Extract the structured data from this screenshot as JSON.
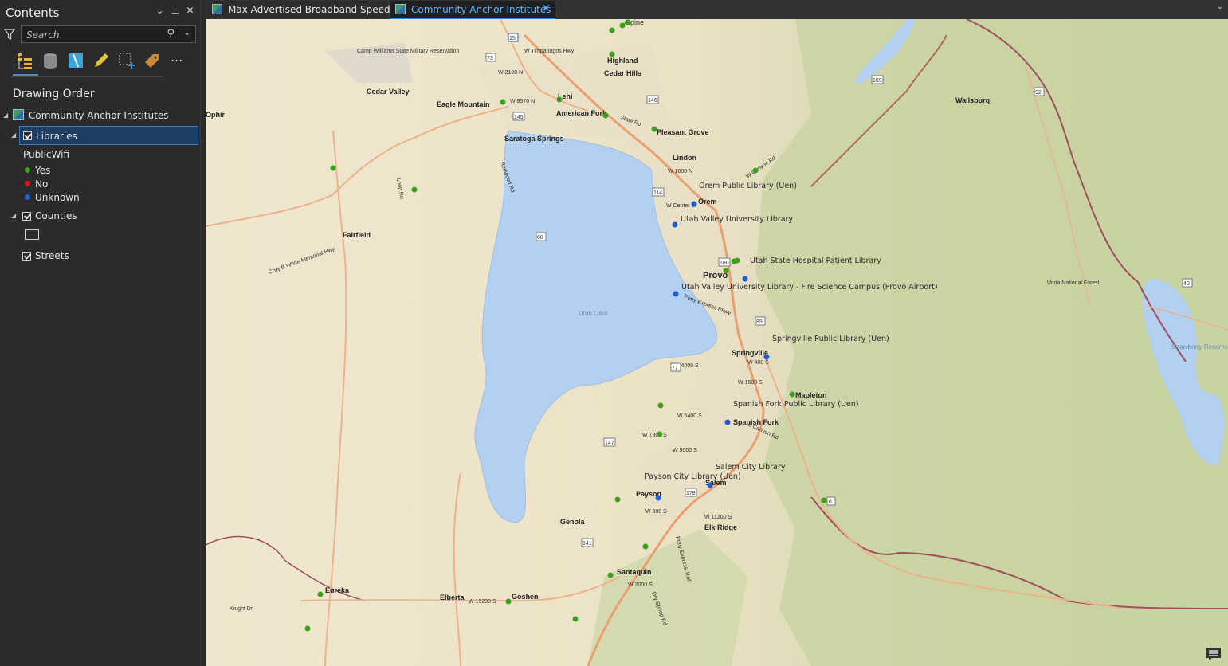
{
  "contents": {
    "title": "Contents",
    "header_icons": [
      "chevron-down-icon",
      "pin-icon",
      "close-icon"
    ],
    "search_placeholder": "Search",
    "toolbar": [
      "list-by-drawing-order-icon",
      "list-by-data-source-icon",
      "list-by-selection-icon",
      "list-by-editing-icon",
      "list-by-snapping-icon",
      "list-by-labeling-icon",
      "more-icon"
    ],
    "more_label": "...",
    "drawing_order": "Drawing Order",
    "map_name": "Community Anchor Institutes",
    "layers": {
      "libraries": {
        "label": "Libraries",
        "checked": true
      },
      "field": "PublicWifi",
      "legend": [
        {
          "label": "Yes",
          "color": "#3aa21a"
        },
        {
          "label": "No",
          "color": "#e0161c"
        },
        {
          "label": "Unknown",
          "color": "#1e5fd6"
        }
      ],
      "counties": {
        "label": "Counties",
        "checked": true
      },
      "streets": {
        "label": "Streets",
        "checked": true
      }
    }
  },
  "tabs": [
    {
      "label": "Max Advertised Broadband Speed",
      "active": false
    },
    {
      "label": "Community Anchor Institutes",
      "active": true
    }
  ],
  "map": {
    "water_labels": [
      "Utah Lake",
      "Strawberry Reservoir"
    ],
    "places": [
      "Alpine",
      "Highland",
      "Cedar Hills",
      "Camp Williams State Military Reservation",
      "Cedar Valley",
      "Eagle Mountain",
      "Lehi",
      "American Fork",
      "Pleasant Grove",
      "Saratoga Springs",
      "Lindon",
      "Orem",
      "Provo",
      "Springville",
      "Mapleton",
      "Spanish Fork",
      "Salem",
      "Payson",
      "Elk Ridge",
      "Genola",
      "Santaquin",
      "Elberta",
      "Goshen",
      "Eureka",
      "Fairfield",
      "Wallsburg",
      "Uinta National Forest",
      "Ophir",
      "Knight Dr"
    ],
    "libraries": [
      {
        "name": "Orem Public Library (Uen)",
        "wifi": "Unknown"
      },
      {
        "name": "Utah Valley University Library",
        "wifi": "Unknown"
      },
      {
        "name": "Utah State Hospital Patient Library",
        "wifi": "Yes"
      },
      {
        "name": "Utah Valley University Library - Fire Science Campus (Provo Airport)",
        "wifi": "Unknown"
      },
      {
        "name": "Springville Public Library (Uen)",
        "wifi": "Unknown"
      },
      {
        "name": "Spanish Fork Public Library (Uen)",
        "wifi": "Unknown"
      },
      {
        "name": "Salem City Library",
        "wifi": "Unknown"
      },
      {
        "name": "Payson City Library (Uen)",
        "wifi": "Unknown"
      }
    ],
    "roads": [
      "W 2100 N",
      "W 8570 N",
      "W 1600 N",
      "W Center St",
      "W 4000 S",
      "W 400 S",
      "W 1600 S",
      "W 6400 S",
      "W 7300 S",
      "W 9000 S",
      "W 800 S",
      "W 11200 S",
      "W 15200 S",
      "W 2000 S",
      "W Timpanogos Hwy",
      "W Canyon Rd",
      "State Rd",
      "Pony Express Pkwy",
      "Redwood Rd",
      "Pony Express Trail",
      "Loop Rd",
      "E Canyon Rd",
      "Dry Spring Rd",
      "Cory B Wride Memorial Hwy"
    ],
    "shields": [
      "15",
      "68",
      "73",
      "89",
      "92",
      "114",
      "141",
      "145",
      "146",
      "147",
      "178",
      "180",
      "189",
      "40",
      "6",
      "77"
    ]
  }
}
